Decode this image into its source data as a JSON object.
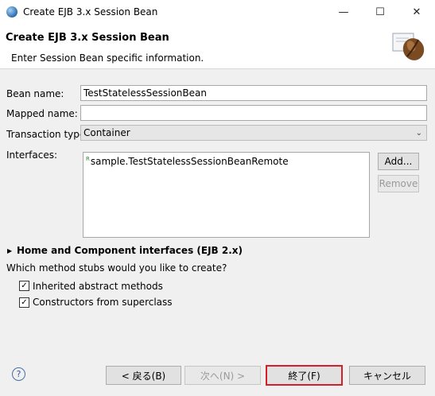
{
  "window": {
    "title": "Create EJB 3.x Session Bean",
    "controls": {
      "minimize": "—",
      "maximize": "☐",
      "close": "✕"
    },
    "icon": "eclipse-icon"
  },
  "header": {
    "title": "Create EJB 3.x Session Bean",
    "subtitle": "Enter Session Bean specific information.",
    "icon": "coffee-bean-icon"
  },
  "form": {
    "bean_name_label": "Bean name:",
    "bean_name_value": "TestStatelessSessionBean",
    "mapped_name_label": "Mapped name:",
    "mapped_name_value": "",
    "transaction_type_label": "Transaction type:",
    "transaction_type_value": "Container",
    "interfaces_label": "Interfaces:",
    "interfaces": [
      {
        "badge": "R",
        "name": "sample.TestStatelessSessionBeanRemote"
      }
    ],
    "add_button": "Add...",
    "remove_button": "Remove"
  },
  "home_section": {
    "title": "Home and Component interfaces (EJB 2.x)",
    "expanded": false
  },
  "stubs": {
    "question": "Which method stubs would you like to create?",
    "options": [
      {
        "label": "Inherited abstract methods",
        "checked": true
      },
      {
        "label": "Constructors from superclass",
        "checked": true
      }
    ]
  },
  "footer": {
    "help": "?",
    "back": "< 戻る(B)",
    "next": "次へ(N) >",
    "finish": "終了(F)",
    "cancel": "キャンセル"
  },
  "colors": {
    "accent_border": "#d3202a",
    "window_bg": "#f0f0f0"
  }
}
